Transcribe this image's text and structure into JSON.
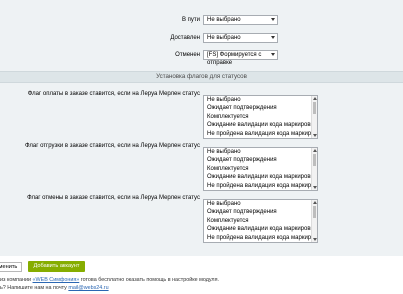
{
  "form": {
    "rows": [
      {
        "label": "В пути",
        "value": "Не выбрано"
      },
      {
        "label": "Доставлен",
        "value": "Не выбрано"
      },
      {
        "label": "Отменен",
        "value": "[FS] Формируется с отправке"
      }
    ]
  },
  "flags_section": {
    "title": "Установка флагов для статусов",
    "fields": [
      {
        "label": "Флаг оплаты в заказе ставится, если на Леруа Мерлен статус"
      },
      {
        "label": "Флаг отгрузки в заказе ставится, если на Леруа Мерлен статус"
      },
      {
        "label": "Флаг отмены в заказе ставится, если на Леруа Мерлен статус"
      }
    ],
    "options": [
      "Не выбрано",
      "Ожидает подтверждения",
      "Комплектуется",
      "Ожидание валидации кода маркировки",
      "Не пройдена валидация кода маркировки"
    ]
  },
  "actions": {
    "secondary_label": "менить",
    "add_account_label": "Добавить аккаунт"
  },
  "footer": {
    "line1_prefix": "из компании",
    "line1_link": "«WEB Симфония»",
    "line1_suffix": "готова бесплатно оказать помощь в настройке модуля.",
    "line2_prefix": "ь? Напишите нам на почту",
    "line2_link": "mail@webs24.ru"
  }
}
